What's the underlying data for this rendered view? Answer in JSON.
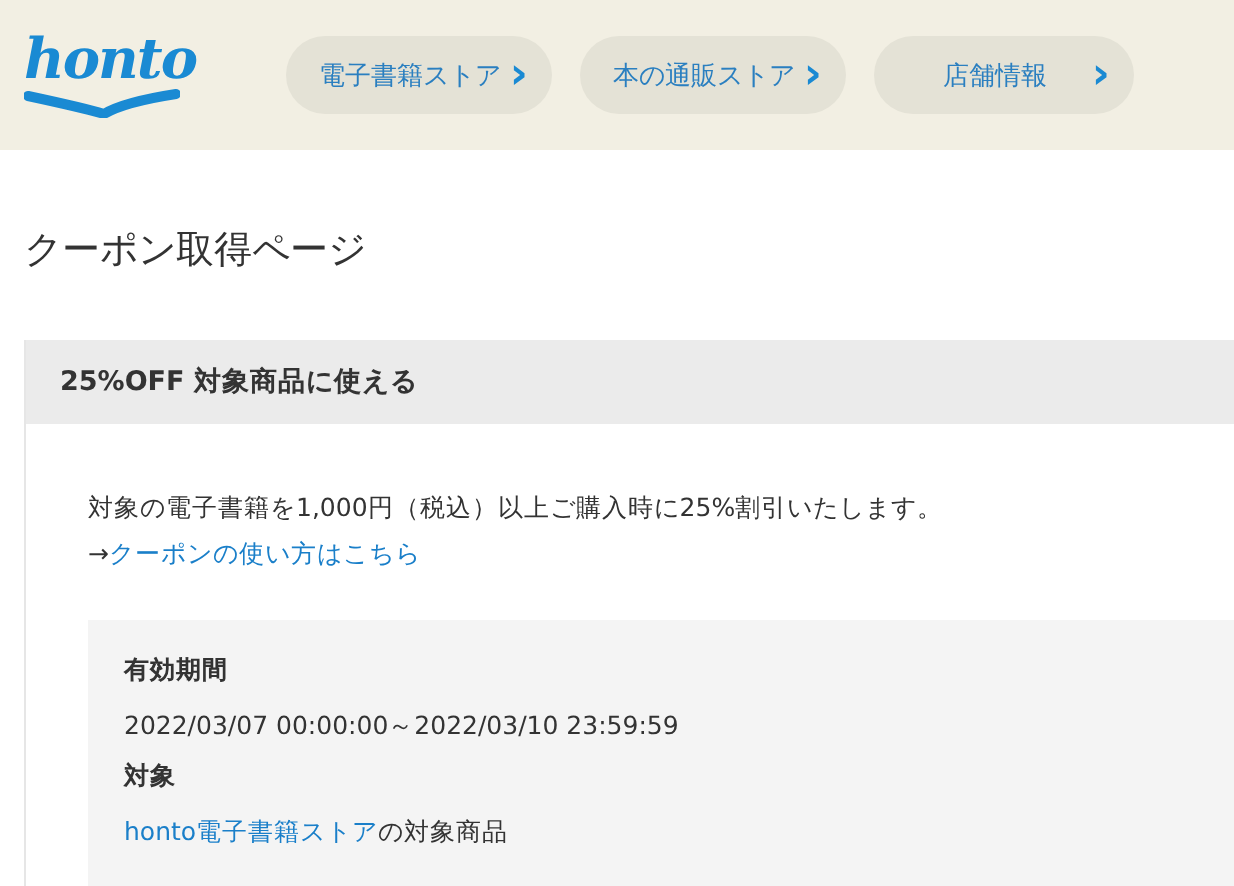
{
  "header": {
    "logo": "honto",
    "nav": [
      {
        "label": "電子書籍ストア",
        "icon": "›"
      },
      {
        "label": "本の通販ストア",
        "icon": "›"
      },
      {
        "label": "店舗情報",
        "icon": "›"
      }
    ]
  },
  "page_title": "クーポン取得ページ",
  "coupon": {
    "title": "25%OFF 対象商品に使える",
    "description": "対象の電子書籍を1,000円（税込）以上ご購入時に25%割引いたします。",
    "guide": {
      "prefix": "→",
      "link": "クーポンの使い方はこちら"
    },
    "details": [
      {
        "label": "有効期間",
        "value": "2022/03/07 00:00:00～2022/03/10 23:59:59"
      },
      {
        "label": "対象",
        "value_link": "honto電子書籍ストア",
        "value": "の対象商品"
      }
    ]
  }
}
